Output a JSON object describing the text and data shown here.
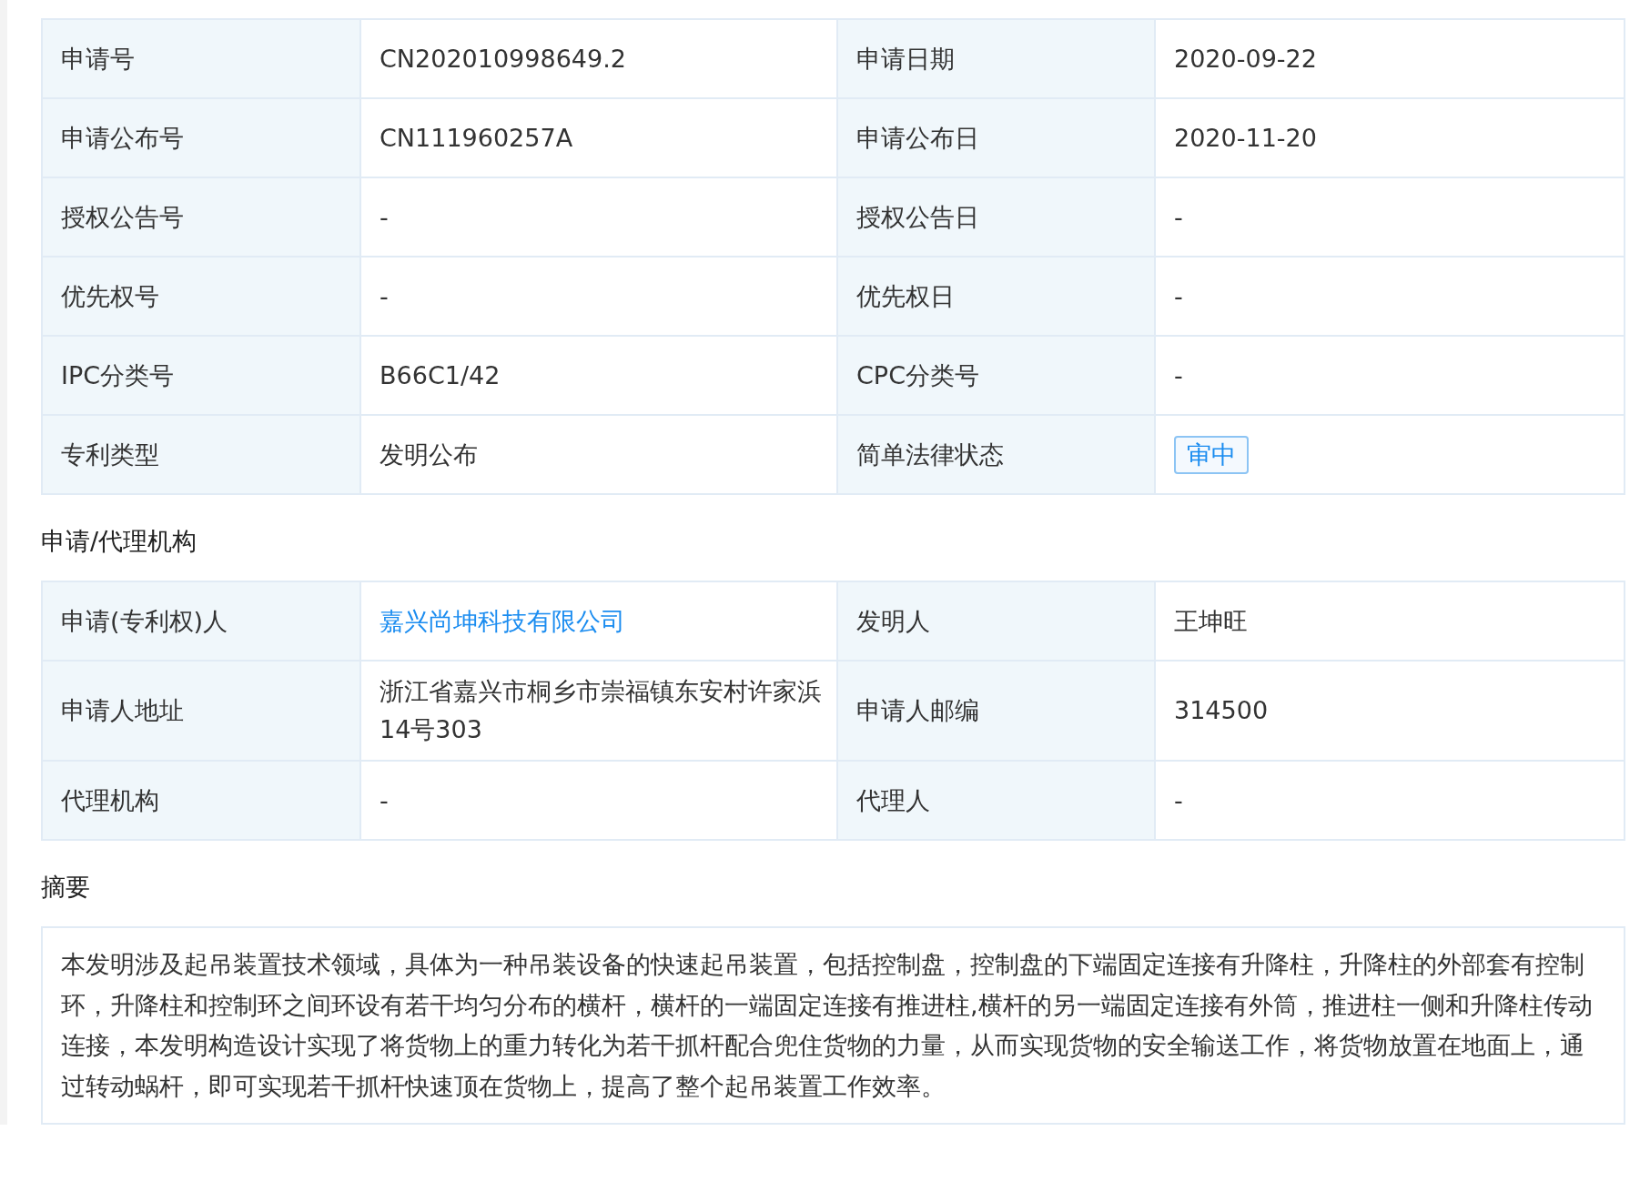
{
  "basic_info": {
    "rows": [
      {
        "cells": [
          {
            "label": "申请号",
            "value": "CN202010998649.2",
            "kind": "text"
          },
          {
            "label": "申请日期",
            "value": "2020-09-22",
            "kind": "text"
          }
        ]
      },
      {
        "cells": [
          {
            "label": "申请公布号",
            "value": "CN111960257A",
            "kind": "text"
          },
          {
            "label": "申请公布日",
            "value": "2020-11-20",
            "kind": "text"
          }
        ]
      },
      {
        "cells": [
          {
            "label": "授权公告号",
            "value": "-",
            "kind": "text"
          },
          {
            "label": "授权公告日",
            "value": "-",
            "kind": "text"
          }
        ]
      },
      {
        "cells": [
          {
            "label": "优先权号",
            "value": "-",
            "kind": "text"
          },
          {
            "label": "优先权日",
            "value": "-",
            "kind": "text"
          }
        ]
      },
      {
        "cells": [
          {
            "label": "IPC分类号",
            "value": "B66C1/42",
            "kind": "text"
          },
          {
            "label": "CPC分类号",
            "value": "-",
            "kind": "text"
          }
        ]
      },
      {
        "cells": [
          {
            "label": "专利类型",
            "value": "发明公布",
            "kind": "text"
          },
          {
            "label": "简单法律状态",
            "value": "审中",
            "kind": "tag"
          }
        ]
      }
    ]
  },
  "agency": {
    "title": "申请/代理机构",
    "rows": [
      {
        "cells": [
          {
            "label": "申请(专利权)人",
            "value": "嘉兴尚坤科技有限公司",
            "kind": "link"
          },
          {
            "label": "发明人",
            "value": "王坤旺",
            "kind": "text"
          }
        ]
      },
      {
        "cells": [
          {
            "label": "申请人地址",
            "value": "浙江省嘉兴市桐乡市崇福镇东安村许家浜14号303",
            "kind": "text"
          },
          {
            "label": "申请人邮编",
            "value": "314500",
            "kind": "text"
          }
        ]
      },
      {
        "cells": [
          {
            "label": "代理机构",
            "value": "-",
            "kind": "text"
          },
          {
            "label": "代理人",
            "value": "-",
            "kind": "text"
          }
        ]
      }
    ]
  },
  "abstract": {
    "title": "摘要",
    "text": "本发明涉及起吊装置技术领域，具体为一种吊装设备的快速起吊装置，包括控制盘，控制盘的下端固定连接有升降柱，升降柱的外部套有控制环，升降柱和控制环之间环设有若干均匀分布的横杆，横杆的一端固定连接有推进柱,横杆的另一端固定连接有外筒，推进柱一侧和升降柱传动连接，本发明构造设计实现了将货物上的重力转化为若干抓杆配合兜住货物的力量，从而实现货物的安全输送工作，将货物放置在地面上，通过转动蜗杆，即可实现若干抓杆快速顶在货物上，提高了整个起吊装置工作效率。"
  }
}
